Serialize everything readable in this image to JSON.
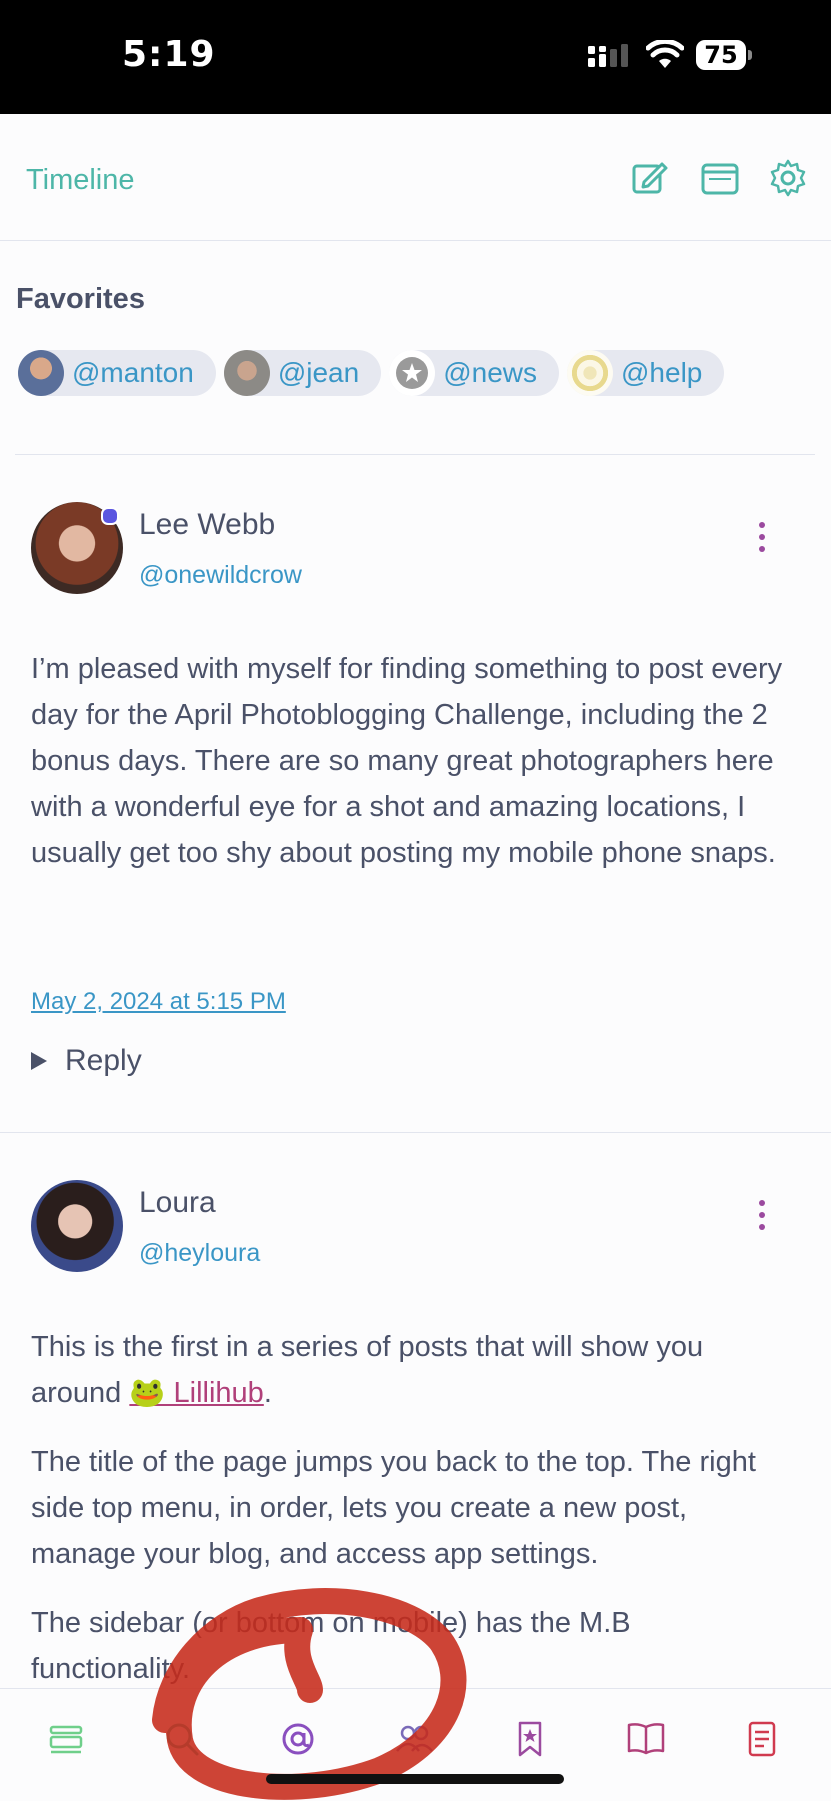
{
  "status": {
    "time": "5:19",
    "battery": "75"
  },
  "header": {
    "title": "Timeline"
  },
  "favorites": {
    "title": "Favorites",
    "items": [
      {
        "label": "@manton"
      },
      {
        "label": "@jean"
      },
      {
        "label": "@news"
      },
      {
        "label": "@help"
      }
    ]
  },
  "posts": [
    {
      "name": "Lee Webb",
      "handle": "@onewildcrow",
      "text": "I’m pleased with myself for finding something to post every day for the April Photoblogging Challenge, including the 2 bonus days. There are so many great photographers here with a wonderful eye for a shot and amazing locations, I usually get too shy about posting my mobile phone snaps.",
      "date": "May 2, 2024 at 5:15 PM",
      "reply": "Reply"
    },
    {
      "name": "Loura",
      "handle": "@heyloura",
      "para1_start": "This is the first in a series of posts that will show you around ",
      "para1_link": "🐸 Lillihub",
      "para1_end": ".",
      "para2": "The title of the page jumps you back to the top. The right side top menu, in order, lets you create a new post, manage your blog, and access app settings.",
      "para3": "The sidebar (or bottom on mobile) has the M.B functionality."
    }
  ],
  "colors": {
    "accent": "#4db6a8",
    "link": "#3a96c6",
    "menu": "#9b4a9f"
  },
  "tabbar": {
    "icons": [
      "timeline-icon",
      "search-icon",
      "mentions-icon",
      "following-icon",
      "bookmarks-icon",
      "bookshelf-icon",
      "notes-icon"
    ]
  }
}
